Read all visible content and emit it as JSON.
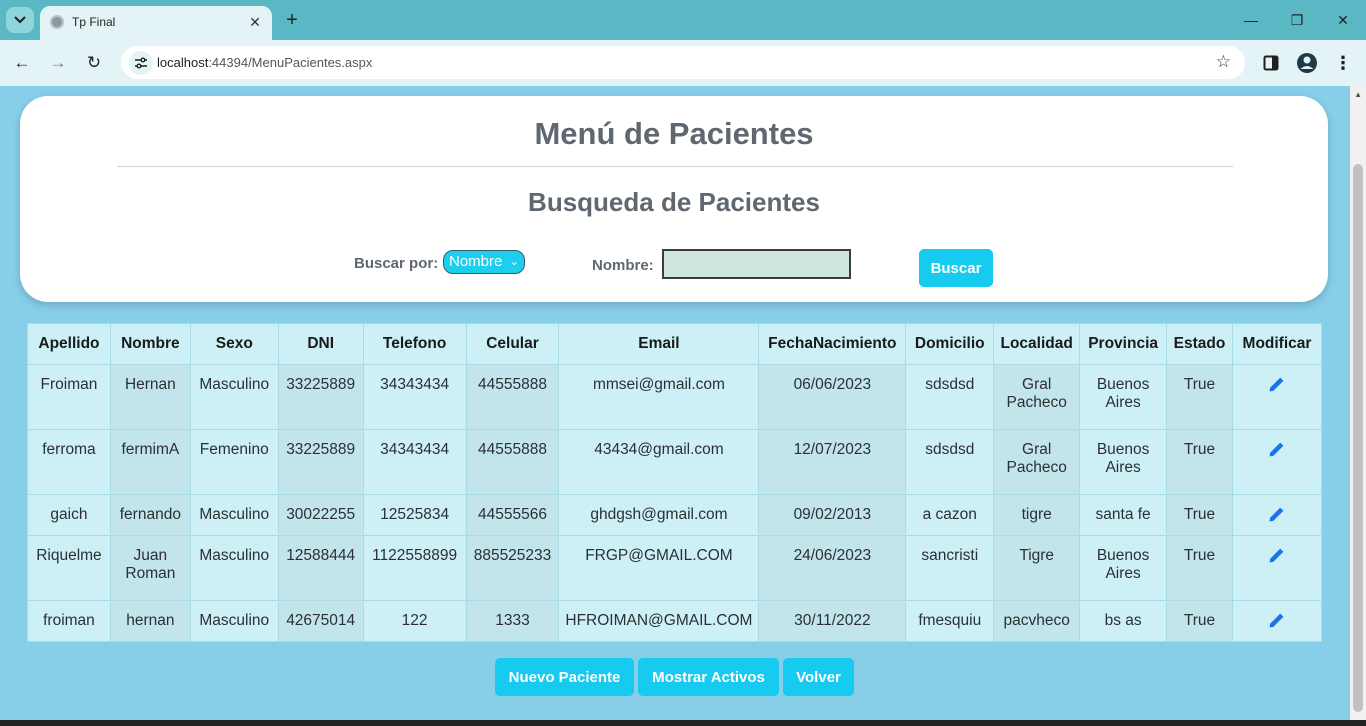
{
  "browser": {
    "tab_title": "Tp Final",
    "url_host": "localhost",
    "url_path": ":44394/MenuPacientes.aspx"
  },
  "page": {
    "title": "Menú de Pacientes",
    "subtitle": "Busqueda de Pacientes",
    "search": {
      "by_label": "Buscar por:",
      "by_value": "Nombre",
      "field_label": "Nombre:",
      "field_value": "",
      "button": "Buscar"
    }
  },
  "table": {
    "headers": [
      "Apellido",
      "Nombre",
      "Sexo",
      "DNI",
      "Telefono",
      "Celular",
      "Email",
      "FechaNacimiento",
      "Domicilio",
      "Localidad",
      "Provincia",
      "Estado",
      "Modificar"
    ],
    "rows": [
      [
        "Froiman",
        "Hernan",
        "Masculino",
        "33225889",
        "34343434",
        "44555888",
        "mmsei@gmail.com",
        "06/06/2023",
        "sdsdsd",
        "Gral Pacheco",
        "Buenos Aires",
        "True"
      ],
      [
        "ferroma",
        "fermimA",
        "Femenino",
        "33225889",
        "34343434",
        "44555888",
        "43434@gmail.com",
        "12/07/2023",
        "sdsdsd",
        "Gral Pacheco",
        "Buenos Aires",
        "True"
      ],
      [
        "gaich",
        "fernando",
        "Masculino",
        "30022255",
        "12525834",
        "44555566",
        "ghdgsh@gmail.com",
        "09/02/2013",
        "a cazon",
        "tigre",
        "santa fe",
        "True"
      ],
      [
        "Riquelme",
        "Juan Roman",
        "Masculino",
        "12588444",
        "1122558899",
        "885525233",
        "FRGP@GMAIL.COM",
        "24/06/2023",
        "sancristi",
        "Tigre",
        "Buenos Aires",
        "True"
      ],
      [
        "froiman",
        "hernan",
        "Masculino",
        "42675014",
        "122",
        "1333",
        "HFROIMAN@GMAIL.COM",
        "30/11/2022",
        "fmesquiu",
        "pacvheco",
        "bs as",
        "True"
      ]
    ]
  },
  "actions": {
    "new_patient": "Nuevo Paciente",
    "show_active": "Mostrar Activos",
    "back": "Volver"
  },
  "colors": {
    "accent": "#16caf0",
    "page_bg": "#87cee9",
    "edit_icon": "#1a73e8"
  }
}
